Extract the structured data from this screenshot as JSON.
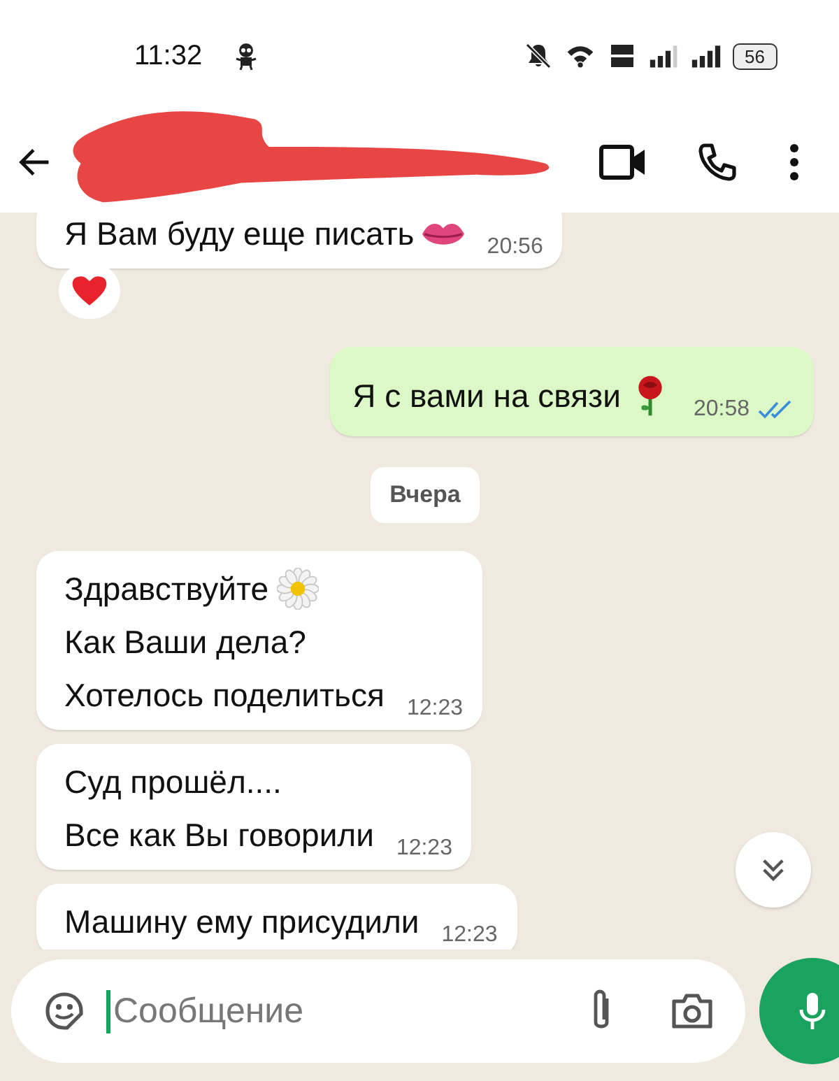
{
  "status_bar": {
    "time": "11:32",
    "battery": "56"
  },
  "composer": {
    "placeholder": "Сообщение"
  },
  "messages": [
    {
      "kind": "incoming",
      "lines": [
        "Я Вам буду еще писать"
      ],
      "time": "20:56"
    },
    {
      "kind": "outgoing",
      "lines": [
        "Я с вами на связи"
      ],
      "time": "20:58",
      "read": true
    },
    {
      "kind": "date",
      "lines": [
        "Вчера"
      ]
    },
    {
      "kind": "incoming",
      "lines": [
        "Здравствуйте",
        "Как Ваши дела?",
        "Хотелось поделиться"
      ],
      "time": "12:23"
    },
    {
      "kind": "incoming",
      "lines": [
        "Суд прошёл....",
        "Все как Вы говорили"
      ],
      "time": "12:23"
    },
    {
      "kind": "incoming",
      "lines": [
        "Машину ему присудили"
      ],
      "time": "12:23"
    }
  ]
}
